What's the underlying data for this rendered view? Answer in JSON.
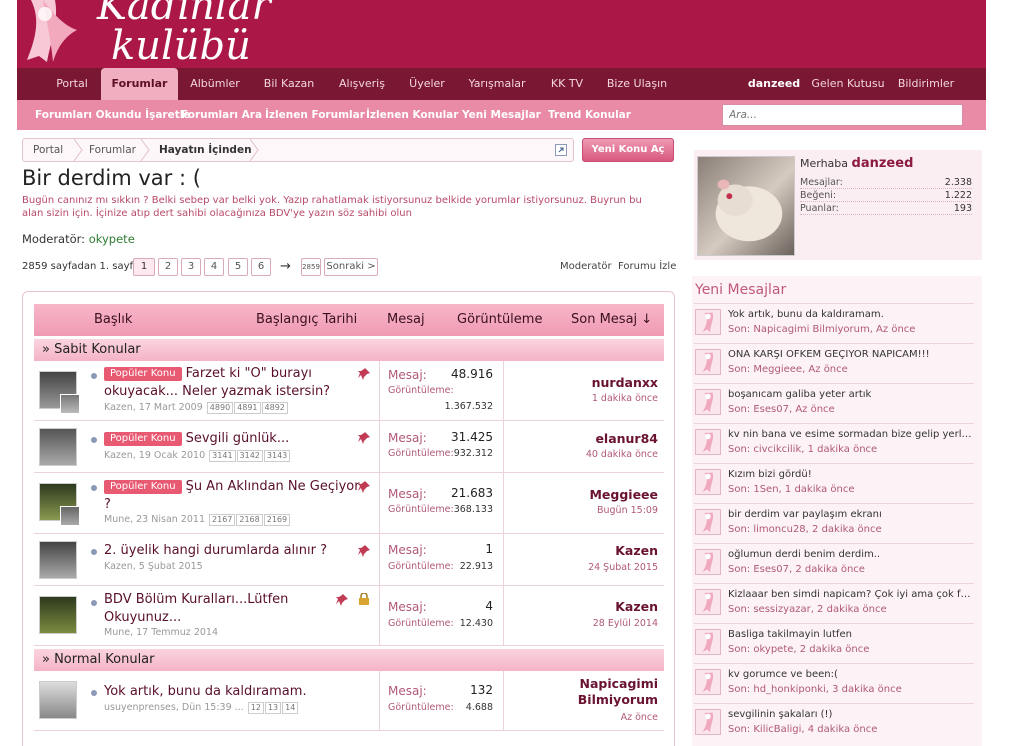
{
  "site": {
    "logo_line1": "Kadınlar",
    "logo_line2": "kulübü"
  },
  "main_nav": {
    "tabs": [
      "Portal",
      "Forumlar",
      "Albümler",
      "Bil Kazan",
      "Alışveriş",
      "Üyeler",
      "Yarışmalar",
      "KK TV",
      "Bize Ulaşın"
    ],
    "active": "Forumlar",
    "user": "danzeed",
    "inbox": "Gelen Kutusu",
    "alerts": "Bildirimler"
  },
  "sub_nav": {
    "items": [
      "Forumları Okundu İşaretle",
      "Forumları Ara",
      "İzlenen Forumlar",
      "İzlenen Konular",
      "Yeni Mesajlar",
      "Trend Konular"
    ],
    "search_placeholder": "Ara..."
  },
  "breadcrumb": [
    "Portal",
    "Forumlar",
    "Hayatın İçinden"
  ],
  "new_thread_label": "Yeni Konu Aç",
  "forum": {
    "title": "Bir derdim var : (",
    "description": "Bugün canınız mı sıkkın ? Belki sebep var belki yok. Yazıp rahatlamak istiyorsunuz belkide yorumlar istiyorsunuz. Buyrun bu alan sizin için. İçinize atıp dert sahibi olacağınıza BDV'ye yazın söz sahibi olun",
    "moderator_label": "Moderatör:",
    "moderator": "okypete"
  },
  "pagination": {
    "summary": "2859 sayfadan 1. sayfa",
    "pages": [
      "1",
      "2",
      "3",
      "4",
      "5",
      "6"
    ],
    "current": "1",
    "arrow": "→",
    "last": "2859",
    "next": "Sonraki >",
    "moderator_link": "Moderatör",
    "watch_link": "Forumu İzle"
  },
  "table": {
    "headers": {
      "title": "Başlık",
      "start_date": "Başlangıç Tarihi",
      "replies": "Mesaj",
      "views": "Görüntüleme",
      "last_post": "Son Mesaj ↓"
    },
    "sections": {
      "sticky": "» Sabit Konular",
      "normal": "» Normal Konular"
    },
    "labels": {
      "replies": "Mesaj:",
      "views": "Görüntüleme:"
    },
    "threads": [
      {
        "prefix": "Popüler Konu",
        "title": "Farzet ki \"O\" burayı okuyacak... Neler yazmak istersin?",
        "starter": "Kazen",
        "date": "17 Mart 2009",
        "pages": [
          "4890",
          "4891",
          "4892"
        ],
        "replies": "48.916",
        "views": "1.367.532",
        "last_user": "nurdanxx",
        "last_time": "1 dakika önce"
      },
      {
        "prefix": "Popüler Konu",
        "title": "Sevgili günlük...",
        "starter": "Kazen",
        "date": "19 Ocak 2010",
        "pages": [
          "3141",
          "3142",
          "3143"
        ],
        "replies": "31.425",
        "views": "932.312",
        "last_user": "elanur84",
        "last_time": "40 dakika önce"
      },
      {
        "prefix": "Popüler Konu",
        "title": "Şu An Aklından Ne Geçiyor ?",
        "starter": "Mune",
        "date": "23 Nisan 2011",
        "pages": [
          "2167",
          "2168",
          "2169"
        ],
        "replies": "21.683",
        "views": "368.133",
        "last_user": "Meggieee",
        "last_time": "Bugün 15:09"
      },
      {
        "prefix": "",
        "title": "2. üyelik hangi durumlarda alınır ?",
        "starter": "Kazen",
        "date": "5 Şubat 2015",
        "pages": [],
        "replies": "1",
        "views": "22.913",
        "last_user": "Kazen",
        "last_time": "24 Şubat 2015"
      },
      {
        "prefix": "",
        "title": "BDV Bölüm Kuralları...Lütfen Okuyunuz...",
        "starter": "Mune",
        "date": "17 Temmuz 2014",
        "pages": [],
        "replies": "4",
        "views": "12.430",
        "last_user": "Kazen",
        "last_time": "28 Eylül 2014"
      },
      {
        "prefix": "",
        "title": "Yok artık, bunu da kaldıramam.",
        "starter": "usuyenprenses",
        "date": "Dün 15:39",
        "pages": [
          "12",
          "13",
          "14"
        ],
        "replies": "132",
        "views": "4.688",
        "last_user": "Napicagimi Bilmiyorum",
        "last_time": "Az önce"
      }
    ]
  },
  "sidebar": {
    "greeting": "Merhaba",
    "username": "danzeed",
    "stats": [
      {
        "k": "Mesajlar:",
        "v": "2.338"
      },
      {
        "k": "Beğeni:",
        "v": "1.222"
      },
      {
        "k": "Puanlar:",
        "v": "193"
      }
    ],
    "new_posts_title": "Yeni Mesajlar",
    "new_posts": [
      {
        "title": "Yok artık, bunu da kaldıramam.",
        "meta": "Son: Napicagimi Bilmiyorum, Az önce"
      },
      {
        "title": "ONA KARŞI ÖFKEM GEÇİYOR NAPICAM!!!",
        "meta": "Son: Meggieee, Az önce"
      },
      {
        "title": "boşanıcam galiba yeter artık",
        "meta": "Son: Eses07, Az önce"
      },
      {
        "title": "kv nin bana ve esime sormadan bize gelip yerles...",
        "meta": "Son: civcikcilik, 1 dakika önce"
      },
      {
        "title": "Kızım bizi gördü!",
        "meta": "Son: 1Sen, 1 dakika önce"
      },
      {
        "title": "bir derdim var paylaşım ekranı",
        "meta": "Son: limoncu28, 2 dakika önce"
      },
      {
        "title": "oğlumun derdi benim derdim..",
        "meta": "Son: Eses07, 2 dakika önce"
      },
      {
        "title": "Kizlaaar ben simdi napicam? Çok iyi ama çok fe...",
        "meta": "Son: sessizyazar, 2 dakika önce"
      },
      {
        "title": "Basliga takilmayin lutfen",
        "meta": "Son: okypete, 2 dakika önce"
      },
      {
        "title": "kv gorumce ve been:(",
        "meta": "Son: hd_honkiponki, 3 dakika önce"
      },
      {
        "title": "sevgilinin şakaları (!)",
        "meta": "Son: KilicBaligi, 4 dakika önce"
      }
    ]
  },
  "colors": {
    "header": "#ab1847",
    "nav": "#7a1733",
    "subnav": "#e98aa6",
    "prefix": "#e85a72",
    "accent": "#c0597a"
  }
}
